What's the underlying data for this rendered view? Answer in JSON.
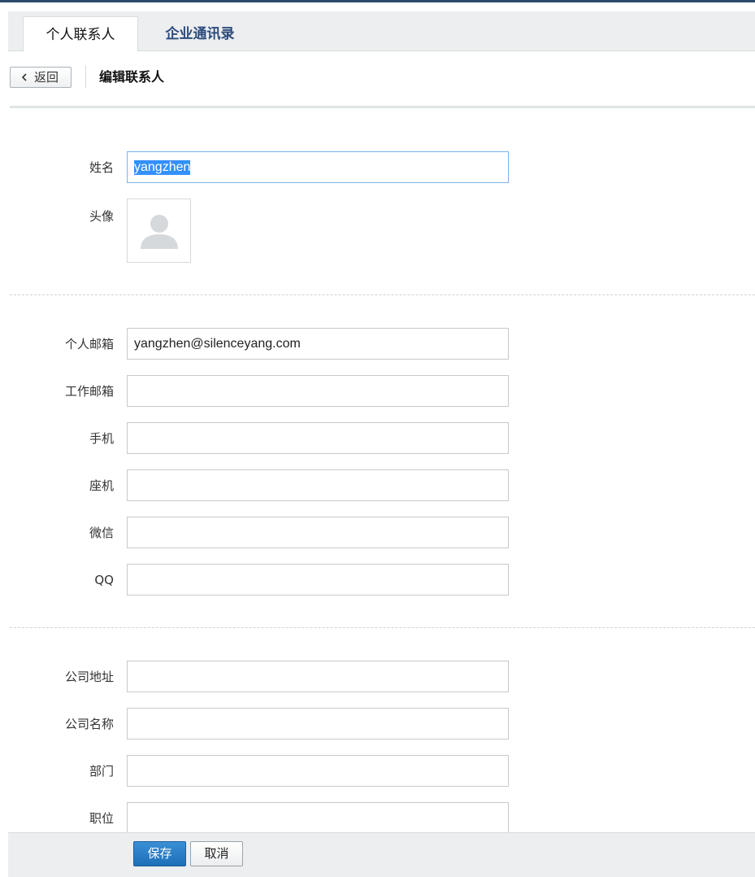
{
  "tabs": [
    {
      "label": "个人联系人",
      "active": true
    },
    {
      "label": "企业通讯录",
      "active": false
    }
  ],
  "toolbar": {
    "back_icon": "chevron-left-icon",
    "back_label": "返回",
    "title": "编辑联系人"
  },
  "form": {
    "name": {
      "label": "姓名",
      "value": "yangzhen"
    },
    "avatar": {
      "label": "头像",
      "icon": "person-silhouette-icon"
    },
    "personal_email": {
      "label": "个人邮箱",
      "value": "yangzhen@silenceyang.com"
    },
    "work_email": {
      "label": "工作邮箱",
      "value": ""
    },
    "mobile": {
      "label": "手机",
      "value": ""
    },
    "landline": {
      "label": "座机",
      "value": ""
    },
    "wechat": {
      "label": "微信",
      "value": ""
    },
    "qq": {
      "label": "QQ",
      "value": ""
    },
    "company_address": {
      "label": "公司地址",
      "value": ""
    },
    "company_name": {
      "label": "公司名称",
      "value": ""
    },
    "department": {
      "label": "部门",
      "value": ""
    },
    "position": {
      "label": "职位",
      "value": ""
    }
  },
  "footer": {
    "save_label": "保存",
    "cancel_label": "取消"
  },
  "colors": {
    "header_line": "#2c4a6b",
    "tab_link": "#2c4a7b",
    "save_button": "#1d6fb8",
    "focus_border": "#7ab3e6"
  }
}
